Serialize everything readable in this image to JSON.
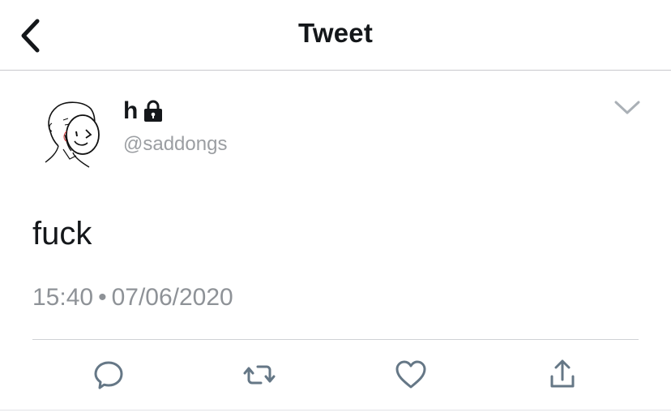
{
  "header": {
    "title": "Tweet",
    "back_icon": "chevron-left-icon"
  },
  "tweet": {
    "author_name": "h",
    "author_handle": "@saddongs",
    "protected_icon": "lock-icon",
    "menu_icon": "chevron-down-icon",
    "text": "fuck",
    "time": "15:40",
    "separator": "•",
    "date": "07/06/2020"
  },
  "actions": [
    {
      "name": "reply",
      "icon": "speech-bubble-icon"
    },
    {
      "name": "retweet",
      "icon": "retweet-icon"
    },
    {
      "name": "like",
      "icon": "heart-icon"
    },
    {
      "name": "share",
      "icon": "share-icon"
    }
  ],
  "colors": {
    "text_primary": "#14171a",
    "text_secondary": "#9b9ea2",
    "icon": "#657786",
    "divider": "#cfd2d6"
  }
}
